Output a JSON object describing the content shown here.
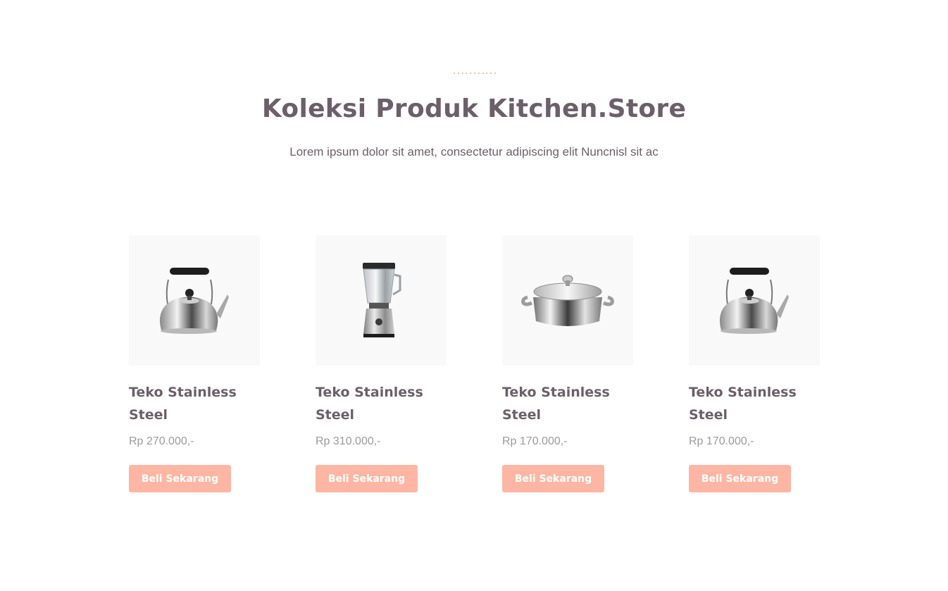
{
  "header": {
    "title": "Koleksi Produk Kitchen.Store",
    "subtitle": "Lorem ipsum dolor sit amet, consectetur adipiscing elit Nuncnisl sit ac"
  },
  "colors": {
    "accent": "#fdb6a3",
    "title": "#6b6069",
    "price": "#9b9b9b",
    "thumb_bg": "#f9f9f9"
  },
  "products": [
    {
      "name": "Teko Stainless Steel",
      "price": "Rp 270.000,-",
      "button": "Beli Sekarang",
      "icon": "kettle-icon"
    },
    {
      "name": "Teko Stainless Steel",
      "price": "Rp 310.000,-",
      "button": "Beli Sekarang",
      "icon": "blender-icon"
    },
    {
      "name": "Teko Stainless Steel",
      "price": "Rp 170.000,-",
      "button": "Beli Sekarang",
      "icon": "pot-icon"
    },
    {
      "name": "Teko Stainless Steel",
      "price": "Rp 170.000,-",
      "button": "Beli Sekarang",
      "icon": "kettle-icon"
    }
  ]
}
